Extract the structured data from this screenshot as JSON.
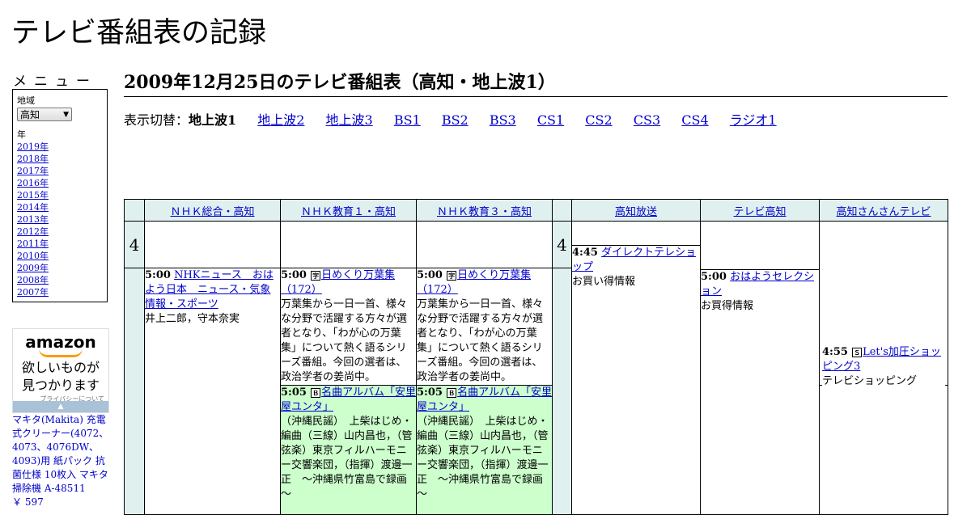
{
  "site_title": "テレビ番組表の記録",
  "menu": {
    "title": "メニュー",
    "region_label": "地域",
    "region_value": "高知",
    "year_label": "年",
    "years": [
      "2019年",
      "2018年",
      "2017年",
      "2016年",
      "2015年",
      "2014年",
      "2013年",
      "2012年",
      "2011年",
      "2010年",
      "2009年",
      "2008年",
      "2007年"
    ]
  },
  "ad": {
    "logo": "amazon",
    "tagline_1": "欲しいものが",
    "tagline_2": "見つかります",
    "privacy": "プライバシーについて",
    "product": "マキタ(Makita) 充電式クリーナー(4072、4073、4076DW、4093)用 紙パック 抗菌仕様 10枚入 マキタ 掃除機 A-48511",
    "price": "￥ 597"
  },
  "heading": "2009年12月25日のテレビ番組表（高知・地上波1）",
  "switcher": {
    "label": "表示切替：",
    "current": "地上波1",
    "links": [
      "地上波2",
      "地上波3",
      "BS1",
      "BS2",
      "BS3",
      "CS1",
      "CS2",
      "CS3",
      "CS4",
      "ラジオ1"
    ]
  },
  "channels": [
    "ＮＨＫ総合・高知",
    "ＮＨＫ教育１・高知",
    "ＮＨＫ教育３・高知",
    "高知放送",
    "テレビ高知",
    "高知さんさんテレビ"
  ],
  "hour": "4",
  "programs": {
    "nhk_g": {
      "time": "5:00",
      "title": "NHKニュース　おはよう日本　ニュース・気象情報・スポーツ",
      "desc": "井上二郎，守本奈実"
    },
    "nhk_e1_a": {
      "time": "5:00",
      "icon": "字",
      "title": "日めくり万葉集（172）",
      "desc": "万葉集から一日一首、様々な分野で活躍する方々が選者となり、「わが心の万葉集」について熱く語るシリーズ番組。今回の選者は、政治学者の姜尚中。"
    },
    "nhk_e1_b": {
      "time": "5:05",
      "icon": "Ｂ",
      "title": "名曲アルバム「安里屋ユンタ」",
      "desc": "（沖縄民謡）　上柴はじめ・編曲（三線）山内昌也，（管弦楽）東京フィルハーモニー交響楽団，（指揮）渡邊一正　～沖縄県竹富島で録画～"
    },
    "nhk_e3_a": {
      "time": "5:00",
      "icon": "字",
      "title": "日めくり万葉集（172）",
      "desc": "万葉集から一日一首、様々な分野で活躍する方々が選者となり、「わが心の万葉集」について熱く語るシリーズ番組。今回の選者は、政治学者の姜尚中。"
    },
    "nhk_e3_b": {
      "time": "5:05",
      "icon": "Ｂ",
      "title": "名曲アルバム「安里屋ユンタ」",
      "desc": "（沖縄民謡）　上柴はじめ・編曲（三線）山内昌也，（管弦楽）東京フィルハーモニー交響楽団，（指揮）渡邊一正　～沖縄県竹富島で録画～"
    },
    "kochi": {
      "time": "4:45",
      "title": "ダイレクトテレショップ",
      "desc": "お買い得情報"
    },
    "tv_kochi": {
      "time": "5:00",
      "title": "おはようセレクション",
      "desc": "お買得情報"
    },
    "sunsun": {
      "time": "4:55",
      "icon": "Ｓ",
      "title": "Let's加圧ショッピング3",
      "desc": "テレビショッピング"
    }
  }
}
